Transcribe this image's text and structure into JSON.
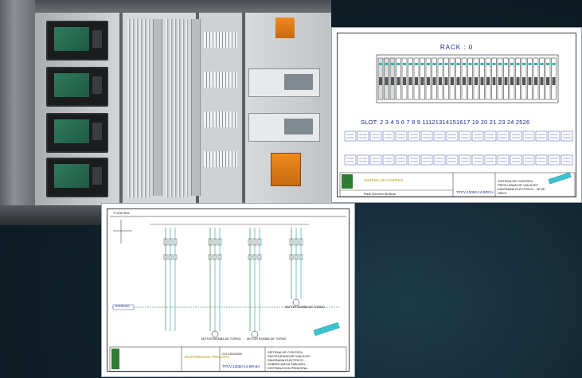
{
  "photo": {
    "description_icon": "electrical-cabinet-photo"
  },
  "rack_sheet": {
    "title": "RACK : 0",
    "slot_label": "SLOT:",
    "slots": "2 3 4 5 6 7 8 9   11121314151617   19 20 21   23 24 2526",
    "title_block_left": "SISTEMA DE CONTROL",
    "title_block_code": "TPCV-13050-14-BRCH",
    "title_block_desc": "SISTEMA DE CONTROL PROCLANADOR VIALEVEF DIAGRAMA ELECTRICO - 3E 6E DBCH",
    "title_block_bottom": "Rack Dmvens Multicar"
  },
  "schem_sheet": {
    "top_label": "T CENTRAL",
    "bus_label": "TERRENO",
    "title_block_yellow": "DISTRIBUCION PRINCIPAL",
    "title_block_code": "TPCV-13050-14-BR-BA",
    "title_block_num": "CO-13120000",
    "title_block_desc": "SISTEMA DE CONTROL PASTEURIZADOR VIALEVEF DIAGRAMA ELECTRICO - SOBRECARGA TABLERO - DISTRIBUCION PRINCIPAL",
    "motor_labels": [
      "MOTOR BOMBA DE TORNO",
      "MOTOR BOMBA DE TORNO",
      "MOTOR BOMBA DE TORNO"
    ]
  }
}
